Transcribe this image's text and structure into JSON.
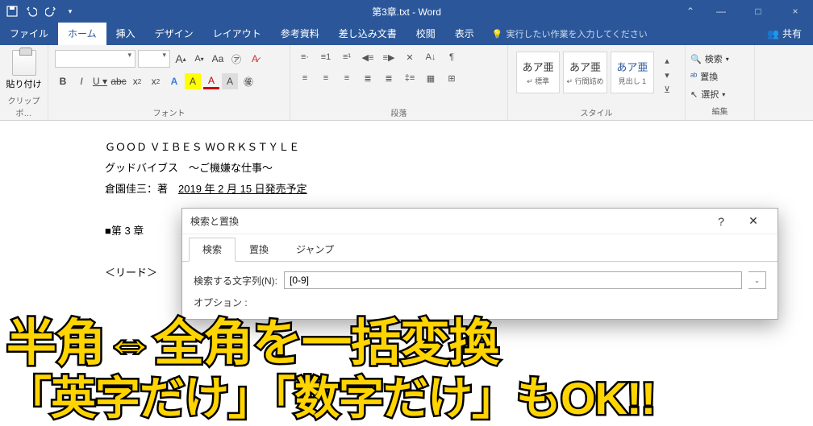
{
  "titlebar": {
    "title": "第3章.txt - Word"
  },
  "window": {
    "minimize": "—",
    "maximize": "□",
    "close": "×"
  },
  "menu": {
    "file": "ファイル",
    "home": "ホーム",
    "insert": "挿入",
    "design": "デザイン",
    "layout": "レイアウト",
    "references": "参考資料",
    "mailings": "差し込み文書",
    "review": "校閲",
    "view": "表示",
    "tell": "実行したい作業を入力してください",
    "share": "共有"
  },
  "ribbon": {
    "clipboard": {
      "paste": "貼り付け",
      "label": "クリップボ…"
    },
    "font": {
      "size": "",
      "sample": "A",
      "label": "フォント"
    },
    "paragraph": {
      "label": "段落"
    },
    "styles": {
      "items": [
        {
          "txt": "あア亜",
          "lbl": "↵ 標準"
        },
        {
          "txt": "あア亜",
          "lbl": "↵ 行間詰め"
        },
        {
          "txt": "あア亜",
          "lbl": "見出し 1"
        }
      ],
      "label": "スタイル"
    },
    "editing": {
      "find": "検索",
      "replace": "置換",
      "select": "選択",
      "label": "編集"
    }
  },
  "doc": {
    "l1": "ＧＯＯＤ ＶＩＢＥＳ ＷＯＲＫＳＴＹＬＥ",
    "l2": "グッドバイブス　～ご機嫌な仕事～",
    "l3a": "倉園佳三：著　",
    "l3b": "2019 年 2 月 15 日発売予定",
    "l4": "■第 3 章",
    "l5": "＜リード＞"
  },
  "dialog": {
    "title": "検索と置換",
    "tabs": {
      "find": "検索",
      "replace": "置換",
      "jump": "ジャンプ"
    },
    "fld_label": "検索する文字列(N):",
    "fld_value": "[0-9]",
    "options": "オプション :"
  },
  "overlay": {
    "line1": "半角⇔全角を一括変換",
    "line2": "「英字だけ」「数字だけ」もOK!!"
  }
}
